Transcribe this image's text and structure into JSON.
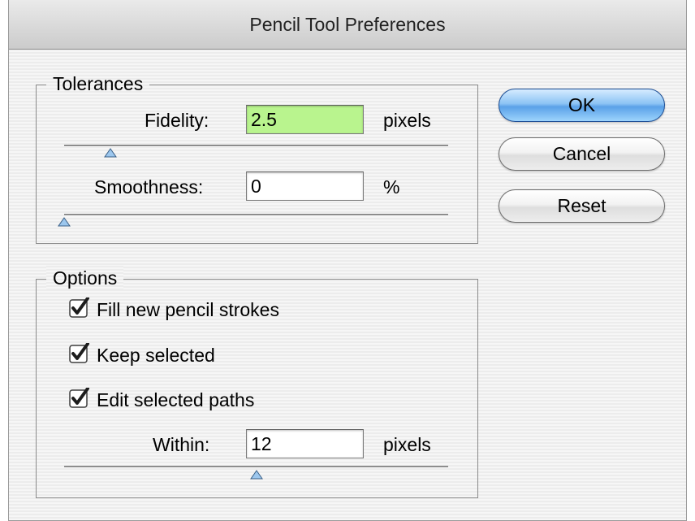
{
  "window": {
    "title": "Pencil Tool Preferences"
  },
  "tolerances": {
    "legend": "Tolerances",
    "fidelity": {
      "label": "Fidelity:",
      "value": "2.5",
      "unit": "pixels",
      "slider_fraction": 0.12
    },
    "smoothness": {
      "label": "Smoothness:",
      "value": "0",
      "unit": "%",
      "slider_fraction": 0.0
    }
  },
  "options": {
    "legend": "Options",
    "checkboxes": [
      {
        "label": "Fill new pencil strokes",
        "checked": true
      },
      {
        "label": "Keep selected",
        "checked": true
      },
      {
        "label": "Edit selected paths",
        "checked": true
      }
    ],
    "within": {
      "label": "Within:",
      "value": "12",
      "unit": "pixels",
      "slider_fraction": 0.5
    }
  },
  "buttons": {
    "ok": "OK",
    "cancel": "Cancel",
    "reset": "Reset"
  },
  "colors": {
    "active_field": "#b9f48e",
    "default_button": "#5aa1e8",
    "check_blue": "#2a63c4"
  }
}
